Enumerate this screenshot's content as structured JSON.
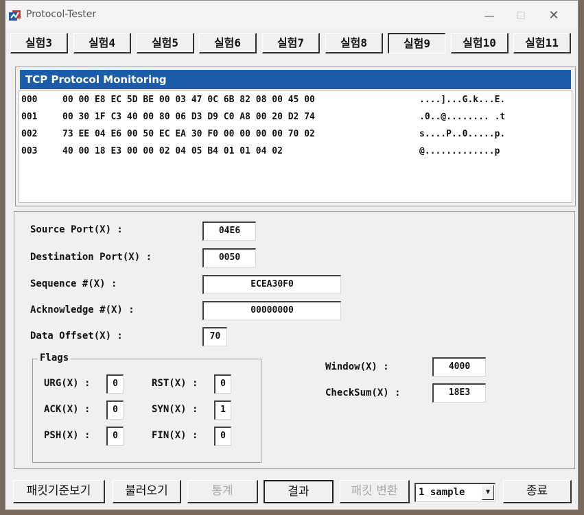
{
  "window": {
    "title": "Protocol-Tester"
  },
  "tabs": [
    {
      "label": "실험3"
    },
    {
      "label": "실험4"
    },
    {
      "label": "실험5"
    },
    {
      "label": "실험6"
    },
    {
      "label": "실험7"
    },
    {
      "label": "실험8"
    },
    {
      "label": "실험9"
    },
    {
      "label": "실험10"
    },
    {
      "label": "실험11"
    }
  ],
  "active_tab": "실험9",
  "hex_panel": {
    "title": "TCP Protocol Monitoring",
    "rows": [
      {
        "offset": "000",
        "bytes": "00 00 E8 EC 5D BE 00 03 47 0C 6B 82 08 00 45 00",
        "ascii": "....]...G.k...E."
      },
      {
        "offset": "001",
        "bytes": "00 30 1F C3 40 00 80 06 D3 D9 C0 A8 00 20 D2 74",
        "ascii": ".0..@........ .t"
      },
      {
        "offset": "002",
        "bytes": "73 EE 04 E6 00 50 EC EA 30 F0 00 00 00 00 70 02",
        "ascii": "s....P..0.....p."
      },
      {
        "offset": "003",
        "bytes": "40 00 18 E3 00 00 02 04 05 B4 01 01 04 02",
        "ascii": "@.............p"
      }
    ]
  },
  "fields": {
    "source_port": {
      "label": "Source Port(X) :",
      "value": "04E6"
    },
    "destination_port": {
      "label": "Destination Port(X) :",
      "value": "0050"
    },
    "sequence": {
      "label": "Sequence #(X) :",
      "value": "ECEA30F0"
    },
    "acknowledge": {
      "label": "Acknowledge #(X) :",
      "value": "00000000"
    },
    "data_offset": {
      "label": "Data Offset(X) :",
      "value": "70"
    },
    "window": {
      "label": "Window(X) :",
      "value": "4000"
    },
    "checksum": {
      "label": "CheckSum(X) :",
      "value": "18E3"
    }
  },
  "flags": {
    "title": "Flags",
    "urg": {
      "label": "URG(X) :",
      "value": "0"
    },
    "ack": {
      "label": "ACK(X) :",
      "value": "0"
    },
    "psh": {
      "label": "PSH(X) :",
      "value": "0"
    },
    "rst": {
      "label": "RST(X) :",
      "value": "0"
    },
    "syn": {
      "label": "SYN(X) :",
      "value": "1"
    },
    "fin": {
      "label": "FIN(X) :",
      "value": "0"
    }
  },
  "buttons": {
    "packet_view": "패킷기준보기",
    "load": "불러오기",
    "stats": "통계",
    "result": "결과",
    "packet_convert": "패킷 변환",
    "exit": "종료"
  },
  "sample_select": {
    "value": "1 sample"
  },
  "icons": {
    "app": "app-logo-icon",
    "dropdown": "chevron-down-icon"
  },
  "colors": {
    "header_blue": "#1c5ca8"
  }
}
